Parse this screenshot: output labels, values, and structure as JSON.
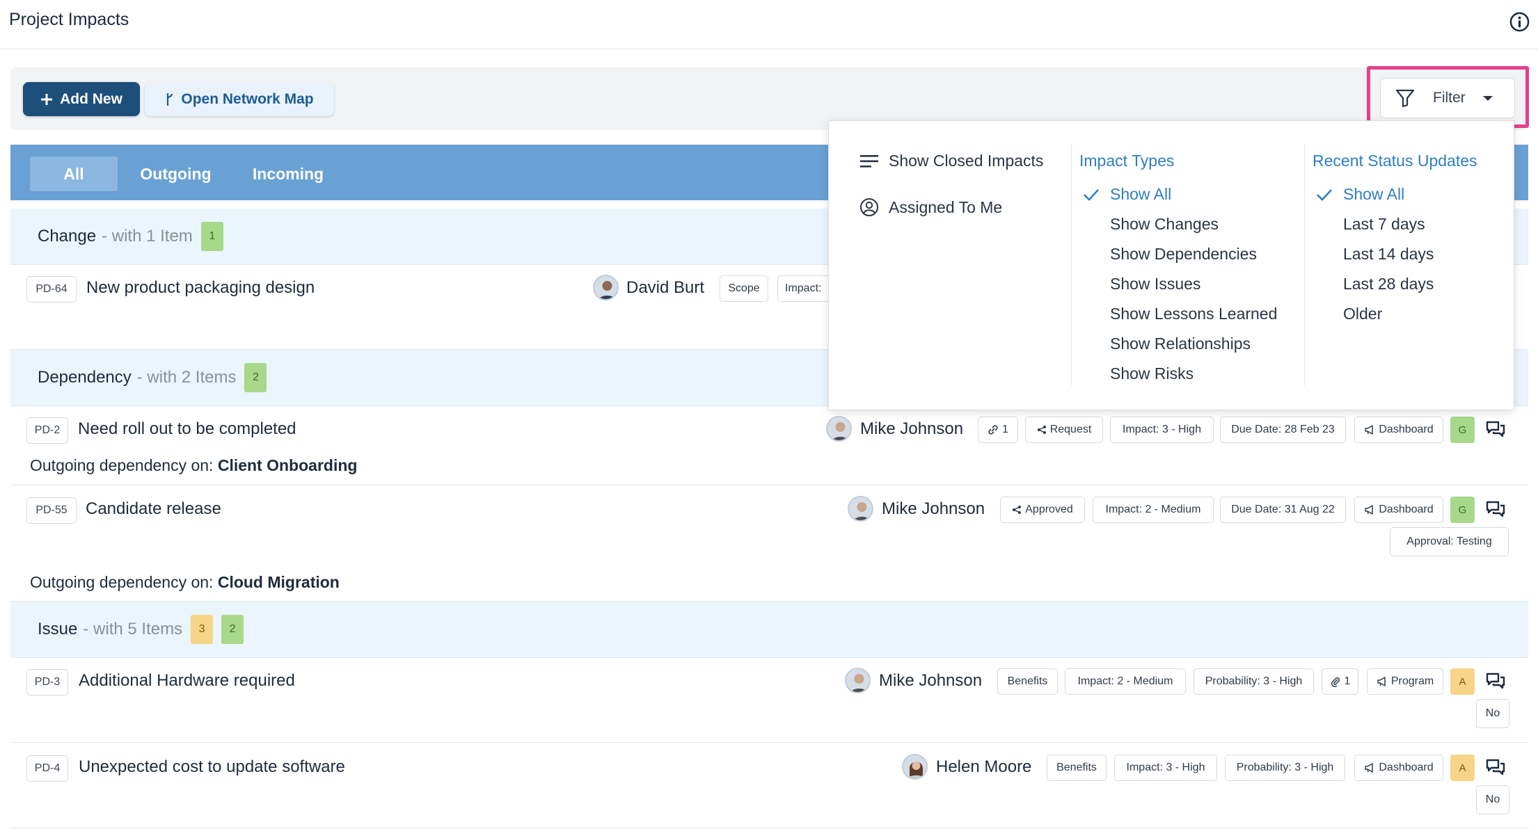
{
  "page": {
    "title": "Project Impacts"
  },
  "toolbar": {
    "add_label": "Add New",
    "network_label": "Open Network Map",
    "filter_label": "Filter"
  },
  "tabs": [
    {
      "label": "All",
      "active": true
    },
    {
      "label": "Outgoing",
      "active": false
    },
    {
      "label": "Incoming",
      "active": false
    }
  ],
  "groups": {
    "change": {
      "name": "Change",
      "sub": "- with 1 Item",
      "badges": [
        "1"
      ]
    },
    "dependency": {
      "name": "Dependency",
      "sub": "- with 2 Items",
      "badges": [
        "2"
      ]
    },
    "issue": {
      "name": "Issue",
      "sub": "- with 5 Items",
      "badges": [
        "3",
        "2"
      ]
    }
  },
  "items": {
    "pd64": {
      "id": "PD-64",
      "title": "New product packaging design",
      "owner": "David Burt",
      "chips": [
        "Scope",
        "Impact:"
      ]
    },
    "pd2": {
      "id": "PD-2",
      "title": "Need roll out to be completed",
      "owner": "Mike Johnson",
      "links": "1",
      "status": "Request",
      "impact": "Impact: 3 - High",
      "due": "Due Date: 28 Feb 23",
      "scope": "Dashboard",
      "rag": "G",
      "note_prefix": "Outgoing dependency on:",
      "note_target": "Client Onboarding"
    },
    "pd55": {
      "id": "PD-55",
      "title": "Candidate release",
      "owner": "Mike Johnson",
      "status": "Approved",
      "impact": "Impact: 2 - Medium",
      "due": "Due Date: 31 Aug 22",
      "scope": "Dashboard",
      "rag": "G",
      "approval": "Approval: Testing",
      "note_prefix": "Outgoing dependency on:",
      "note_target": "Cloud Migration"
    },
    "pd3": {
      "id": "PD-3",
      "title": "Additional Hardware required",
      "owner": "Mike Johnson",
      "category": "Benefits",
      "impact": "Impact: 2 - Medium",
      "probability": "Probability: 3 - High",
      "attachments": "1",
      "scope": "Program",
      "rag": "A",
      "flag": "No"
    },
    "pd4": {
      "id": "PD-4",
      "title": "Unexpected cost to update software",
      "owner": "Helen Moore",
      "category": "Benefits",
      "impact": "Impact: 3 - High",
      "probability": "Probability: 3 - High",
      "scope": "Dashboard",
      "rag": "A",
      "flag": "No"
    }
  },
  "filter_menu": {
    "options": [
      "Show Closed Impacts",
      "Assigned To Me"
    ],
    "impact_types": {
      "heading": "Impact Types",
      "items": [
        "Show All",
        "Show Changes",
        "Show Dependencies",
        "Show Issues",
        "Show Lessons Learned",
        "Show Relationships",
        "Show Risks"
      ],
      "selected": "Show All"
    },
    "status_updates": {
      "heading": "Recent Status Updates",
      "items": [
        "Show All",
        "Last 7 days",
        "Last 14 days",
        "Last 28 days",
        "Older"
      ],
      "selected": "Show All"
    }
  },
  "colors": {
    "primary": "#1d4f7a",
    "tab_bar": "#6aa1d4",
    "highlight": "#e6408c",
    "link_blue": "#2f7fc4",
    "rag_green": "#a8d88a",
    "rag_amber": "#f7d488"
  },
  "icons": [
    "info-icon",
    "plus-icon",
    "branch-icon",
    "filter-icon",
    "chevron-down-icon",
    "list-icon",
    "user-circle-icon",
    "check-icon",
    "link-icon",
    "share-icon",
    "megaphone-icon",
    "comments-icon",
    "paperclip-icon"
  ]
}
